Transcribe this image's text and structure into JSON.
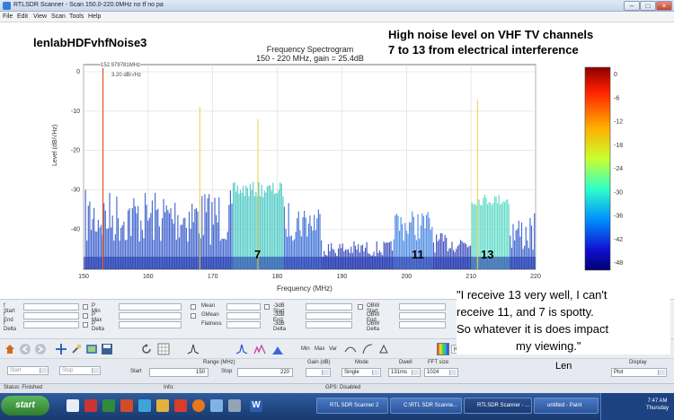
{
  "window": {
    "title": "RTLSDR Scanner - Scan 150.0-220.0MHz no tf no pa"
  },
  "menu": [
    "File",
    "Edit",
    "View",
    "Scan",
    "Tools",
    "Help"
  ],
  "plot": {
    "title_line1": "Frequency Spectrogram",
    "title_line2": "150 - 220 MHz, gain = 25.4dB",
    "peak_label": "152.979781MHz",
    "peak_level": "3.20 dB/√Hz",
    "xlabel": "Frequency (MHz)",
    "ylabel": "Level (dB/√Hz)",
    "xticks": [
      "150",
      "160",
      "170",
      "180",
      "190",
      "200",
      "210",
      "220"
    ],
    "yticks": [
      "0",
      "-10",
      "-20",
      "-30",
      "-40"
    ],
    "colorbar_ticks": [
      "0",
      "-6",
      "-12",
      "-18",
      "-24",
      "-30",
      "-36",
      "-42",
      "-48"
    ]
  },
  "annotations": {
    "filename": "lenlabHDFvhfNoise3",
    "headline_line1": "High noise level on VHF TV channels",
    "headline_line2": "7 to 13 from electrical interference",
    "ch7": "7",
    "ch11": "11",
    "ch13": "13",
    "quote_line1": "\"I receive 13 very well, I can't",
    "quote_line2": "receive 11, and 7 is spotty.",
    "quote_line3": "So whatever it is does impact",
    "quote_line4": "my  viewing.\"",
    "signature": "Len"
  },
  "measure_panel": {
    "col1": [
      "f Start",
      "f End",
      "f Delta"
    ],
    "col2": [
      "P Min",
      "P Max",
      "P Delta"
    ],
    "col3": [
      "Mean",
      "GMean",
      "Flatness"
    ],
    "col4": [
      "-3dB Start",
      "-3dB End",
      "-3dB Delta"
    ],
    "col5": [
      "OBW Start",
      "OBW End",
      "OBW Delta"
    ]
  },
  "toolbar": {
    "mode_labels": [
      "Min",
      "Max",
      "Var"
    ],
    "colormap_value": "jet"
  },
  "controls": {
    "start_dropdown": "Start",
    "stop_dropdown": "Stop",
    "range_label": "Range (MHz)",
    "start_label": "Start",
    "start_value": "150",
    "stop_label": "Stop",
    "stop_value": "220",
    "gain_label": "Gain (dB)",
    "mode_label": "Mode",
    "mode_value": "Single",
    "dwell_label": "Dwell",
    "dwell_value": "131ms",
    "fft_label": "FFT size",
    "fft_value": "1024",
    "display_label": "Display",
    "display_value": "Plot"
  },
  "status": {
    "left": "Status: Finished",
    "info": "Info:",
    "gps": "GPS: Disabled"
  },
  "taskbar": {
    "start": "start",
    "tasks": [
      "RTL SDR Scanner 2",
      "C:\\RTL SDR Scanne...",
      "RTLSDR Scanner - ...",
      "untitled - Paint"
    ],
    "clock_time": "7:47 AM",
    "clock_day": "Thursday"
  },
  "colors": {
    "accent_text": "#000000",
    "trace": "#2a52c9",
    "noise_band": "#4fd6c2",
    "peak_marker": "#e0561f"
  }
}
